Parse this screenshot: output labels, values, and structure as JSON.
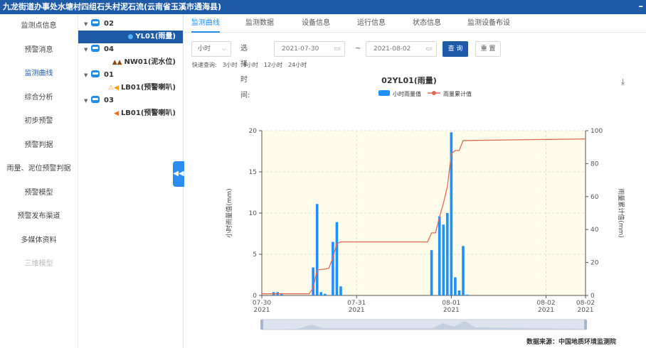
{
  "window": {
    "title": "九龙街道办事处水塘村四组石头村泥石流(云南省玉溪市通海县)",
    "close": "–"
  },
  "nav": [
    {
      "label": "监测点信息",
      "active": false,
      "disabled": false
    },
    {
      "label": "预警消息",
      "active": false,
      "disabled": false
    },
    {
      "label": "监测曲线",
      "active": true,
      "disabled": false
    },
    {
      "label": "综合分析",
      "active": false,
      "disabled": false
    },
    {
      "label": "初步预警",
      "active": false,
      "disabled": false
    },
    {
      "label": "预警判据",
      "active": false,
      "disabled": false
    },
    {
      "label": "雨量、泥位预警判据",
      "active": false,
      "disabled": false
    },
    {
      "label": "预警模型",
      "active": false,
      "disabled": false
    },
    {
      "label": "预警发布渠道",
      "active": false,
      "disabled": false
    },
    {
      "label": "多媒体资料",
      "active": false,
      "disabled": false
    },
    {
      "label": "三维模型",
      "active": false,
      "disabled": true
    }
  ],
  "tree": [
    {
      "group": "02",
      "items": [
        {
          "label": "YL01(雨量)",
          "icon": "droplet-icon",
          "selected": true
        }
      ]
    },
    {
      "group": "04",
      "items": [
        {
          "label": "NW01(泥水位)",
          "icon": "mud-level-icon",
          "selected": false
        }
      ]
    },
    {
      "group": "01",
      "items": [
        {
          "label": "LB01(预警喇叭)",
          "icon": "warning-speaker-icon",
          "selected": false
        }
      ]
    },
    {
      "group": "03",
      "items": [
        {
          "label": "LB01(预警喇叭)",
          "icon": "speaker-icon",
          "selected": false
        }
      ]
    }
  ],
  "tabs": [
    "监测曲线",
    "监测数据",
    "设备信息",
    "运行信息",
    "状态信息",
    "监测设备布设"
  ],
  "filters": {
    "interval": "小时",
    "time_label": "选择时间:",
    "start": "2021-07-30",
    "sep": "~",
    "end": "2021-08-02",
    "query": "查 询",
    "reset": "重 置"
  },
  "quick": {
    "label": "快速查询:",
    "options": [
      "3小时",
      "6小时",
      "12小时",
      "24小时"
    ]
  },
  "source": "数据来源：中国地质环境监测院",
  "colors": {
    "bar": "#1e90ff",
    "line": "#e06a55",
    "plot_bg": "#fffde9",
    "primary": "#1f5aa6"
  },
  "chart_data": {
    "type": "bar",
    "title": "02YL01(雨量)",
    "legend": [
      "小时雨量值",
      "雨量累计值"
    ],
    "legend_position": "top-center",
    "ylabel": "小时雨量值(mm)",
    "y2label": "雨量累计值(mm)",
    "ylim": [
      0,
      20
    ],
    "y2lim": [
      0,
      100
    ],
    "yticks": [
      0,
      5,
      10,
      15,
      20
    ],
    "y2ticks": [
      0,
      20,
      40,
      60,
      80,
      100
    ],
    "xlim": [
      0,
      82
    ],
    "xticks": [
      {
        "h": 0,
        "label": [
          "07-30",
          "2021"
        ]
      },
      {
        "h": 24,
        "label": [
          "07-31",
          "2021"
        ]
      },
      {
        "h": 48,
        "label": [
          "08-01",
          "2021"
        ]
      },
      {
        "h": 72,
        "label": [
          "08-02",
          "2021"
        ]
      },
      {
        "h": 82,
        "label": [
          "08-02",
          "2021"
        ]
      }
    ],
    "grid": true,
    "series": [
      {
        "name": "小时雨量值",
        "type": "bar",
        "x": [
          3,
          4,
          5,
          13,
          14,
          15,
          16,
          18,
          19,
          20,
          43,
          45,
          46,
          47,
          48,
          49,
          50,
          51,
          52
        ],
        "values": [
          0.4,
          0.4,
          0.2,
          3.4,
          11.1,
          0.4,
          0.2,
          6.5,
          8.9,
          1.1,
          5.5,
          9.6,
          8.6,
          10.0,
          19.8,
          2.2,
          0.6,
          6.0,
          0.1
        ]
      },
      {
        "name": "雨量累计值",
        "type": "line",
        "x": [
          0,
          12,
          13,
          14,
          16,
          17,
          18,
          19,
          20,
          42,
          43,
          44,
          45,
          46,
          47,
          48,
          49,
          50,
          51,
          82
        ],
        "values": [
          1,
          1,
          4.5,
          15.5,
          16,
          16.5,
          23,
          31.5,
          32.5,
          32.5,
          38,
          38,
          47.5,
          56,
          66,
          86,
          88,
          88,
          94,
          95
        ]
      }
    ]
  }
}
